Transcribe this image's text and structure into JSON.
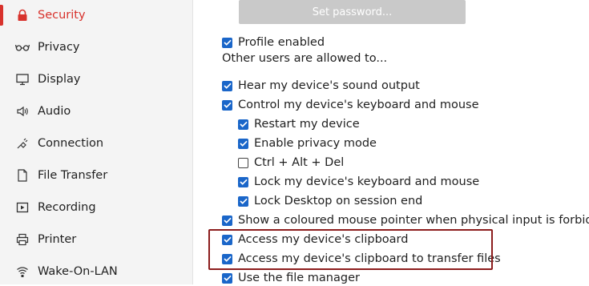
{
  "sidebar": {
    "items": [
      {
        "label": "Security",
        "icon": "lock-icon",
        "active": true
      },
      {
        "label": "Privacy",
        "icon": "glasses-icon"
      },
      {
        "label": "Display",
        "icon": "monitor-icon"
      },
      {
        "label": "Audio",
        "icon": "speaker-icon"
      },
      {
        "label": "Connection",
        "icon": "plug-icon"
      },
      {
        "label": "File Transfer",
        "icon": "file-icon"
      },
      {
        "label": "Recording",
        "icon": "record-icon"
      },
      {
        "label": "Printer",
        "icon": "printer-icon"
      },
      {
        "label": "Wake-On-LAN",
        "icon": "wifi-icon"
      }
    ],
    "accent_color": "#d8322c"
  },
  "main": {
    "set_password_label": "Set password...",
    "profile_enabled": {
      "label": "Profile enabled",
      "checked": true
    },
    "allowed_heading": "Other users are allowed to...",
    "permissions": [
      {
        "label": "Hear my device's sound output",
        "checked": true
      },
      {
        "label": "Control my device's keyboard and mouse",
        "checked": true
      },
      {
        "label": "Restart my device",
        "checked": true
      },
      {
        "label": "Enable privacy mode",
        "checked": true
      },
      {
        "label": "Ctrl + Alt + Del",
        "checked": false
      },
      {
        "label": "Lock my device's keyboard and mouse",
        "checked": true
      },
      {
        "label": "Lock Desktop on session end",
        "checked": true
      },
      {
        "label": "Show a coloured mouse pointer when physical input is forbidden",
        "checked": true
      },
      {
        "label": "Access my device's clipboard",
        "checked": true
      },
      {
        "label": "Access my device's clipboard to transfer files",
        "checked": true
      },
      {
        "label": "Use the file manager",
        "checked": true
      }
    ],
    "checkbox_color": "#1a66c9",
    "highlight_color": "#8c1d1d"
  }
}
